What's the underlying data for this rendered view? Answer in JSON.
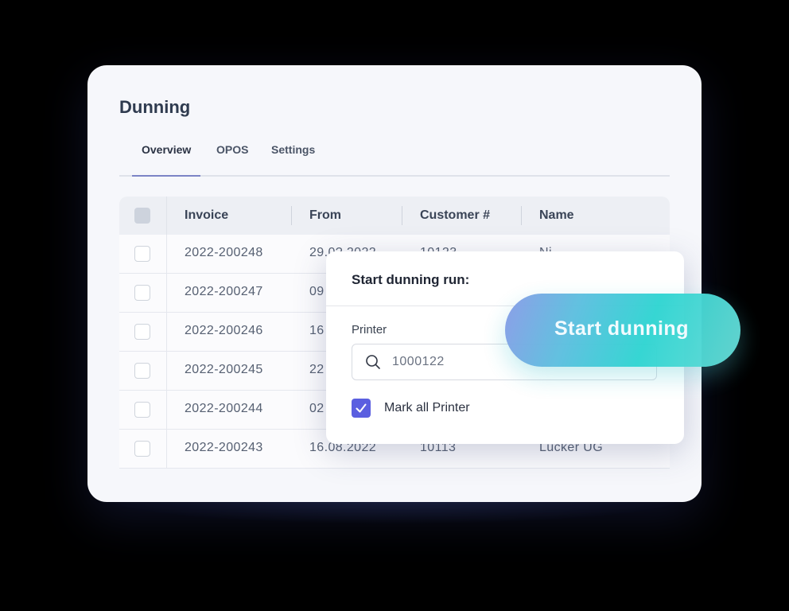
{
  "page": {
    "title": "Dunning"
  },
  "tabs": [
    {
      "label": "Overview",
      "active": true
    },
    {
      "label": "OPOS",
      "active": false
    },
    {
      "label": "Settings",
      "active": false
    }
  ],
  "table": {
    "columns": [
      "Invoice",
      "From",
      "Customer #",
      "Name"
    ],
    "rows": [
      {
        "invoice": "2022-200248",
        "from": "29.0?.2022",
        "customer": "10123",
        "name": "Ni..."
      },
      {
        "invoice": "2022-200247",
        "from": "09",
        "customer": "",
        "name": ""
      },
      {
        "invoice": "2022-200246",
        "from": "16",
        "customer": "",
        "name": ""
      },
      {
        "invoice": "2022-200245",
        "from": "22",
        "customer": "",
        "name": ""
      },
      {
        "invoice": "2022-200244",
        "from": "02",
        "customer": "",
        "name": ""
      },
      {
        "invoice": "2022-200243",
        "from": "16.08.2022",
        "customer": "10113",
        "name": "Lücker UG"
      }
    ]
  },
  "modal": {
    "title": "Start dunning run:",
    "printer_label": "Printer",
    "printer_value": "1000122",
    "checkbox_label": "Mark all Printer",
    "checkbox_checked": true
  },
  "cta": {
    "label": "Start dunning"
  },
  "colors": {
    "accent": "#5b5fe0",
    "cta_start": "#8a9ce8",
    "cta_end": "#30d5d2"
  }
}
